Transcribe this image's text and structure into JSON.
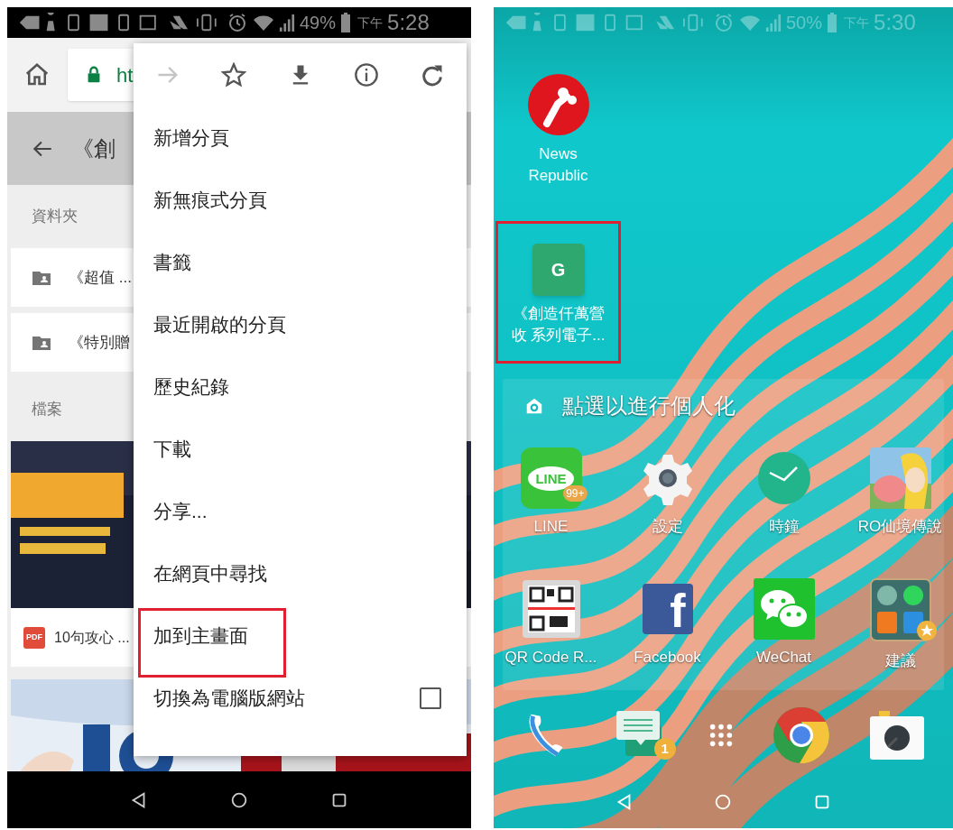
{
  "left_phone": {
    "status_bar": {
      "battery": "49%",
      "time_prefix": "下午",
      "time": "5:28"
    },
    "address_bar": {
      "url": "ht"
    },
    "page_header": {
      "title": "《創"
    },
    "sections": [
      {
        "heading": "資料夾",
        "items": [
          {
            "kind": "folder",
            "label": "《超值 ..."
          },
          {
            "kind": "folder",
            "label": "《特別贈"
          }
        ]
      },
      {
        "heading": "檔案",
        "items": [
          {
            "kind": "picture"
          },
          {
            "kind": "pdf",
            "icon_text": "PDF",
            "label": "10句攻心 ..."
          },
          {
            "kind": "picture"
          }
        ]
      }
    ],
    "menu": {
      "toolbar": [
        {
          "kind": "forward",
          "disabled": true
        },
        {
          "kind": "star",
          "disabled": false
        },
        {
          "kind": "download",
          "disabled": false
        },
        {
          "kind": "info",
          "disabled": false
        },
        {
          "kind": "reload",
          "disabled": false
        }
      ],
      "items": [
        {
          "kind": "plain",
          "label": "新增分頁",
          "highlighted": false
        },
        {
          "kind": "plain",
          "label": "新無痕式分頁",
          "highlighted": false
        },
        {
          "kind": "plain",
          "label": "書籤",
          "highlighted": false
        },
        {
          "kind": "plain",
          "label": "最近開啟的分頁",
          "highlighted": false
        },
        {
          "kind": "plain",
          "label": "歷史紀錄",
          "highlighted": false
        },
        {
          "kind": "plain",
          "label": "下載",
          "highlighted": false
        },
        {
          "kind": "plain",
          "label": "分享...",
          "highlighted": false
        },
        {
          "kind": "plain",
          "label": "在網頁中尋找",
          "highlighted": false
        },
        {
          "kind": "plain",
          "label": "加到主畫面",
          "highlighted": true
        },
        {
          "kind": "checkbox",
          "label": "切換為電腦版網站",
          "highlighted": false,
          "checked": false
        }
      ]
    }
  },
  "right_phone": {
    "status_bar": {
      "battery": "50%",
      "time_prefix": "下午",
      "time": "5:30"
    },
    "shortcuts": [
      {
        "kind": "news",
        "label_lines": [
          "News",
          "Republic"
        ],
        "highlighted": false
      },
      {
        "kind": "letter",
        "letter": "G",
        "label_lines": [
          "《創造仟萬營",
          "收 系列電子..."
        ],
        "highlighted": true
      }
    ],
    "widget": {
      "text": "點選以進行個人化"
    },
    "apps": [
      {
        "kind": "line",
        "icon_text": "LINE",
        "badge": "99+",
        "label": "LINE"
      },
      {
        "kind": "settings",
        "label": "設定"
      },
      {
        "kind": "clock",
        "label": "時鐘"
      },
      {
        "kind": "game",
        "label": "RO仙境傳說"
      },
      {
        "kind": "qr",
        "label": "QR Code R..."
      },
      {
        "kind": "facebook",
        "icon_text": "f",
        "label": "Facebook"
      },
      {
        "kind": "wechat",
        "label": "WeChat"
      },
      {
        "kind": "folder",
        "label": "建議"
      }
    ],
    "dock": [
      {
        "kind": "phone"
      },
      {
        "kind": "messages",
        "badge": "1"
      },
      {
        "kind": "apps"
      },
      {
        "kind": "chrome"
      },
      {
        "kind": "camera"
      }
    ]
  }
}
